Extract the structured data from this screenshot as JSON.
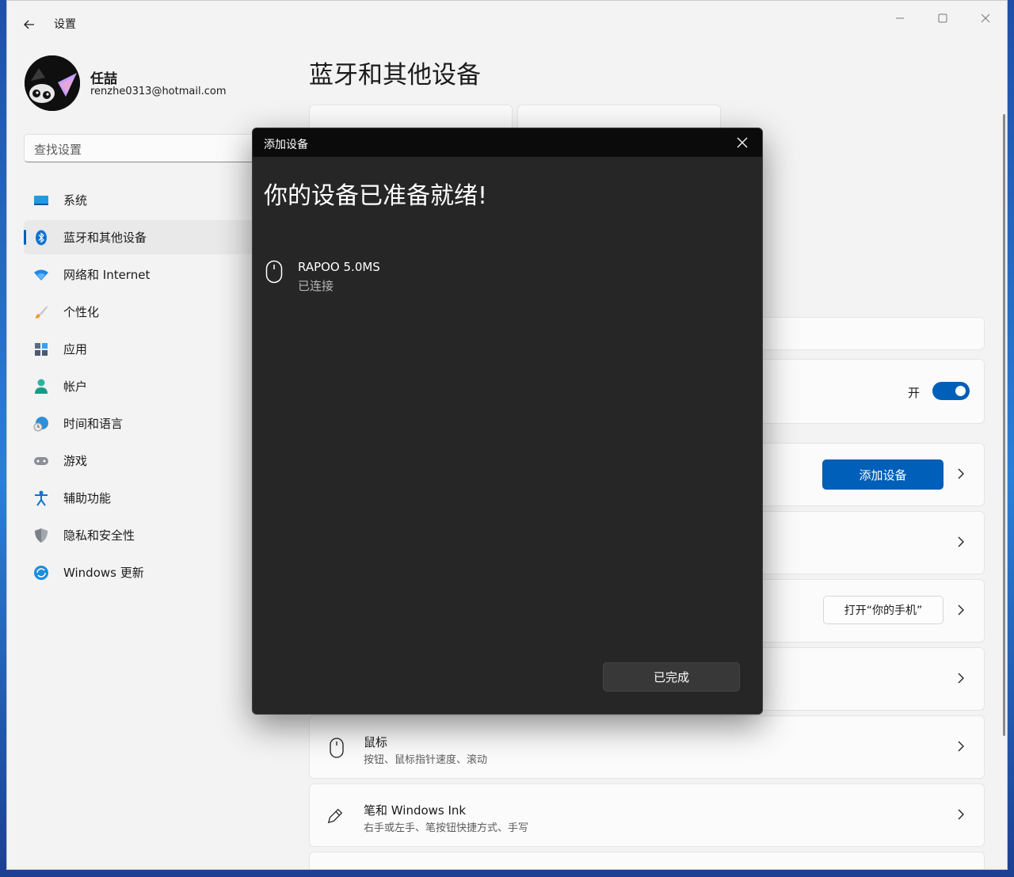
{
  "window": {
    "title": "设置"
  },
  "profile": {
    "name": "任喆",
    "email": "renzhe0313@hotmail.com"
  },
  "search": {
    "placeholder": "查找设置"
  },
  "nav": {
    "items": [
      {
        "label": "系统",
        "icon": "monitor-icon"
      },
      {
        "label": "蓝牙和其他设备",
        "icon": "bluetooth-icon",
        "active": true
      },
      {
        "label": "网络和 Internet",
        "icon": "wifi-icon"
      },
      {
        "label": "个性化",
        "icon": "brush-icon"
      },
      {
        "label": "应用",
        "icon": "apps-icon"
      },
      {
        "label": "帐户",
        "icon": "person-icon"
      },
      {
        "label": "时间和语言",
        "icon": "globe-clock-icon"
      },
      {
        "label": "游戏",
        "icon": "gamepad-icon"
      },
      {
        "label": "辅助功能",
        "icon": "accessibility-icon"
      },
      {
        "label": "隐私和安全性",
        "icon": "shield-icon"
      },
      {
        "label": "Windows 更新",
        "icon": "sync-icon"
      }
    ]
  },
  "main": {
    "title": "蓝牙和其他设备",
    "bluetooth_toggle": {
      "label": "开",
      "on": true
    },
    "add_device_button": "添加设备",
    "phone_link_button": "打开“你的手机”",
    "rows": [
      {
        "title": "鼠标",
        "subtitle": "按钮、鼠标指针速度、滚动",
        "icon": "mouse-icon"
      },
      {
        "title": "笔和 Windows Ink",
        "subtitle": "右手或左手、笔按钮快捷方式、手写",
        "icon": "pen-icon"
      }
    ]
  },
  "dialog": {
    "title": "添加设备",
    "heading": "你的设备已准备就绪!",
    "device": {
      "name": "RAPOO 5.0MS",
      "status": "已连接",
      "icon": "mouse-icon"
    },
    "done_button": "已完成"
  },
  "colors": {
    "accent": "#005fb8",
    "dialog_bg": "#262626",
    "dialog_titlebar": "#0b0b0b"
  }
}
